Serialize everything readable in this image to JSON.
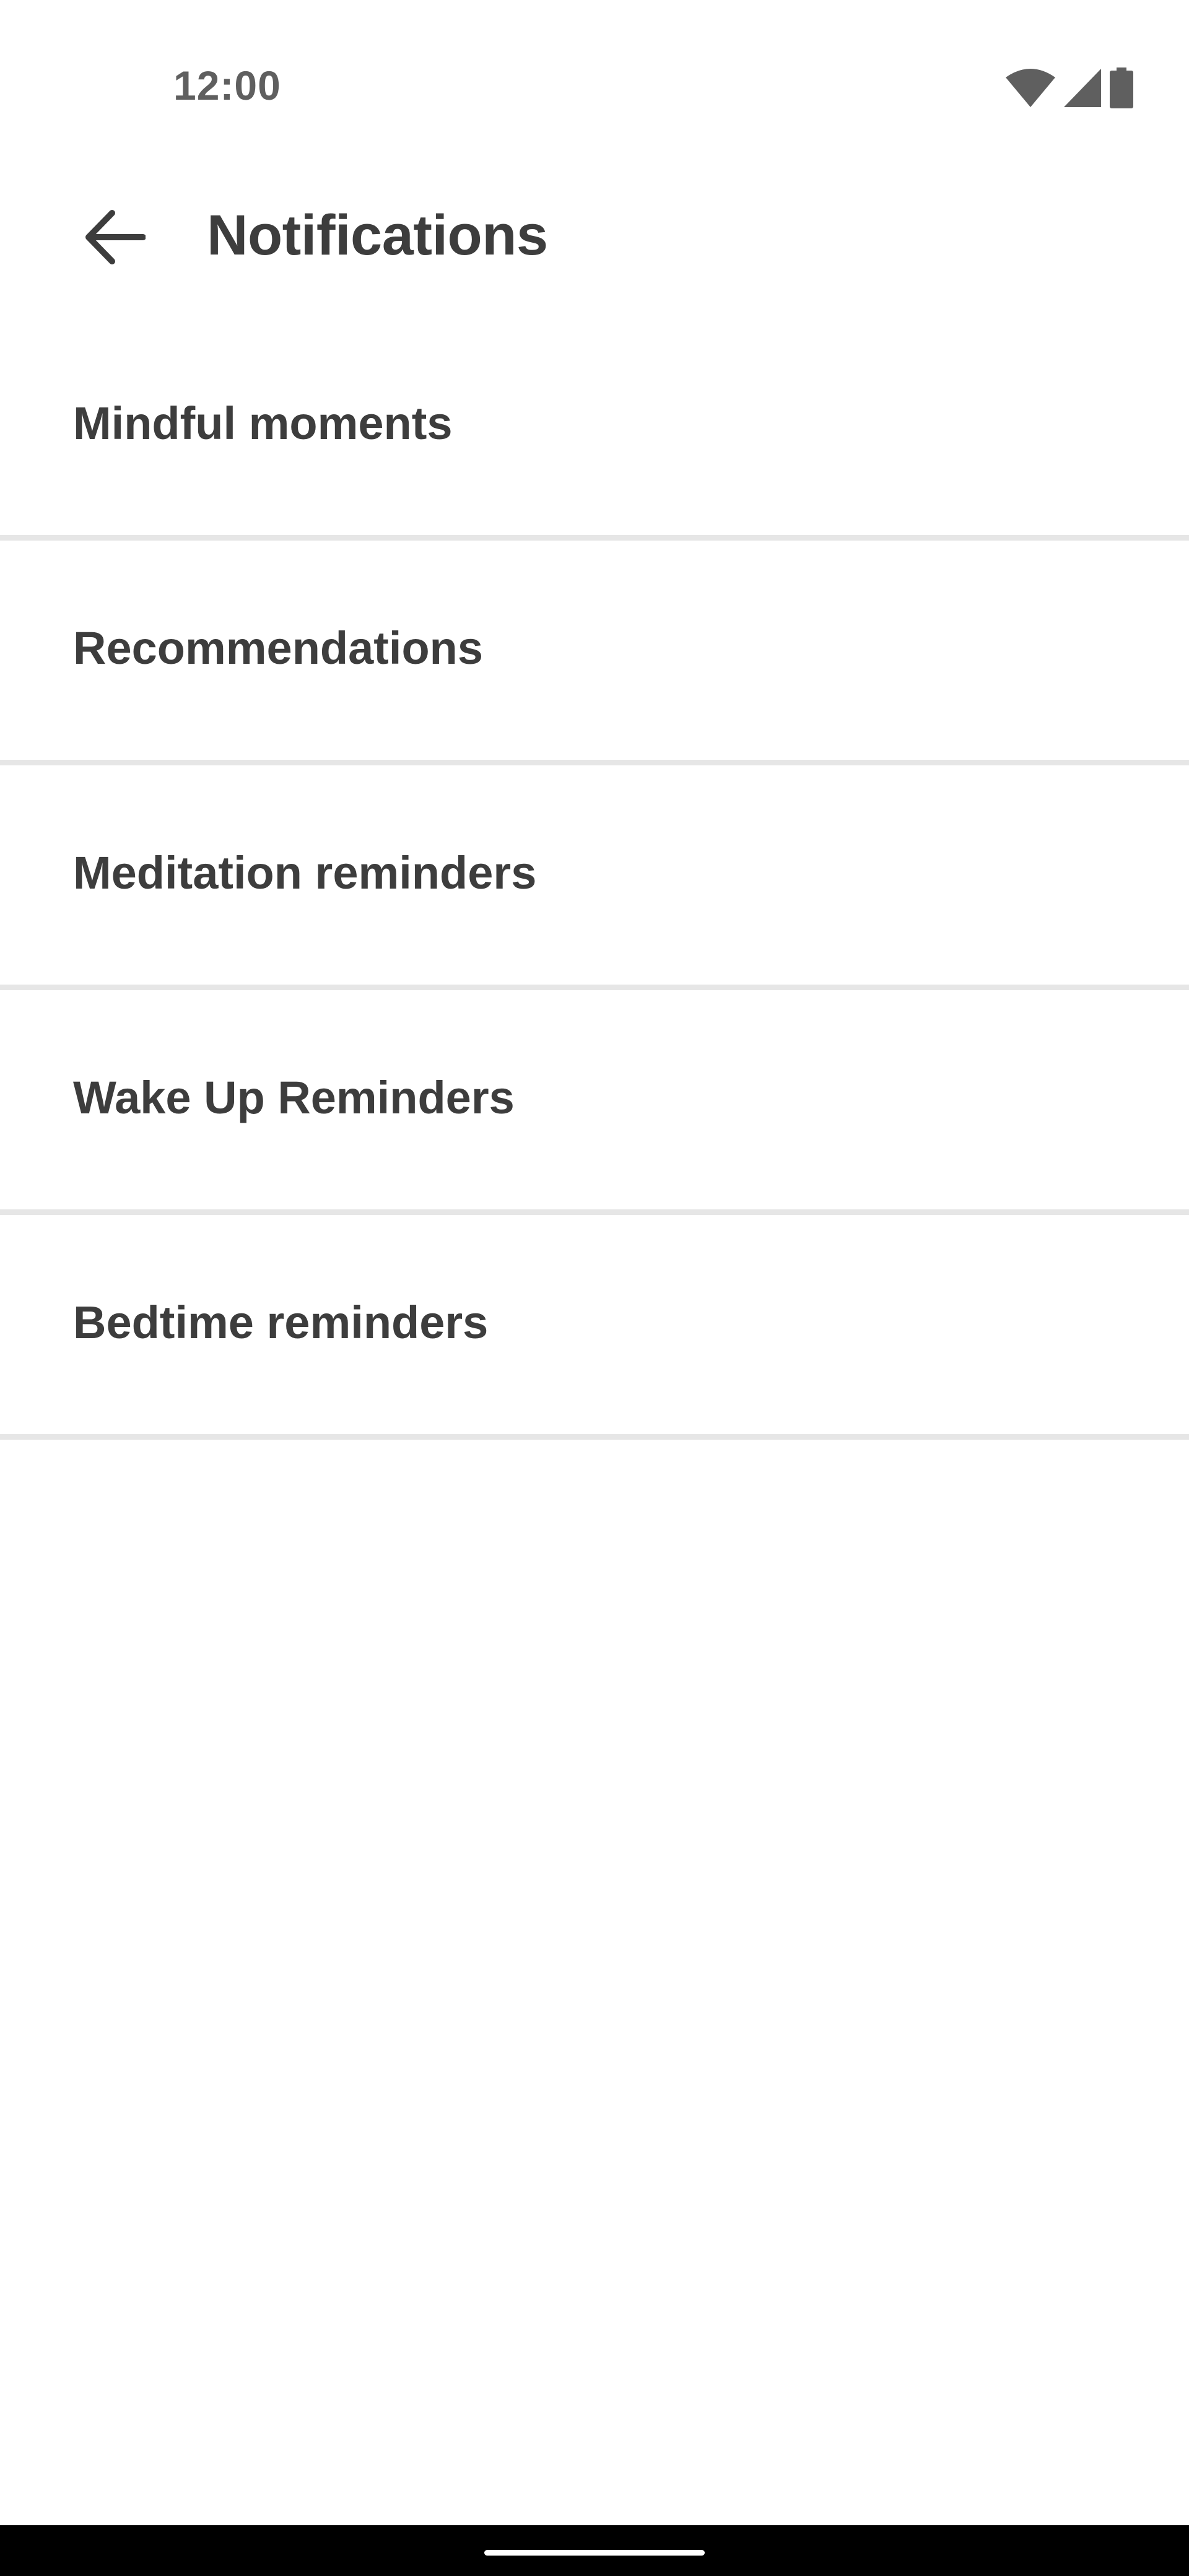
{
  "status_bar": {
    "time": "12:00",
    "icons": [
      "wifi-icon",
      "cellular-signal-icon",
      "battery-icon"
    ]
  },
  "app_bar": {
    "back_icon": "arrow-left-icon",
    "title": "Notifications"
  },
  "settings": {
    "items": [
      {
        "label": "Mindful moments"
      },
      {
        "label": "Recommendations"
      },
      {
        "label": "Meditation reminders"
      },
      {
        "label": "Wake Up Reminders"
      },
      {
        "label": "Bedtime reminders"
      }
    ]
  },
  "colors": {
    "text": "#3d3d3d",
    "status_text": "#5f5f5f",
    "divider": "#e6e6e6",
    "background": "#ffffff",
    "nav_bar": "#000000"
  }
}
